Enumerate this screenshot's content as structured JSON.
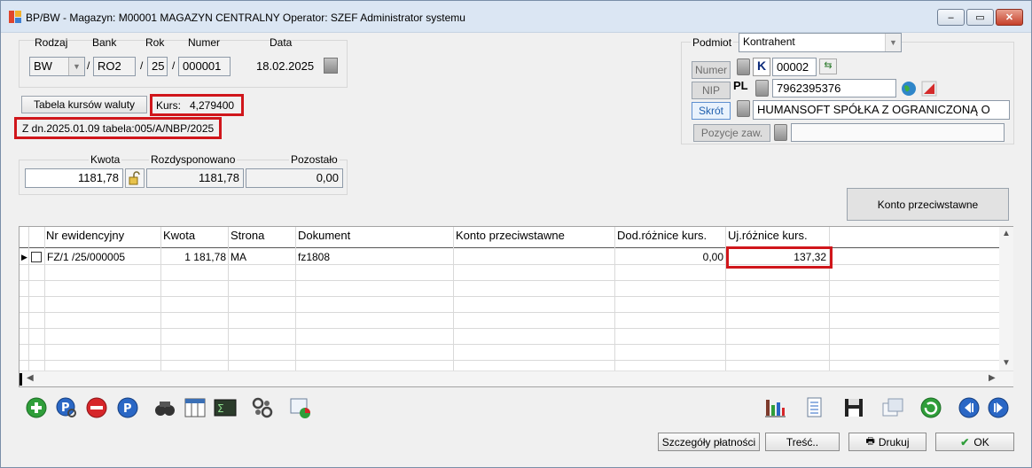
{
  "window": {
    "title": "BP/BW - Magazyn: M00001 MAGAZYN CENTRALNY  Operator: SZEF Administrator systemu",
    "minimize": "–",
    "maximize": "▭",
    "close": "✕"
  },
  "header": {
    "rodzaj_label": "Rodzaj",
    "bank_label": "Bank",
    "rok_label": "Rok",
    "numer_label": "Numer",
    "data_label": "Data",
    "rodzaj_value": "BW",
    "bank_value": "RO2",
    "rok_value": "25",
    "numer_value": "000001",
    "data_value": "18.02.2025",
    "slash": "/"
  },
  "exchange": {
    "table_button": "Tabela kursów waluty",
    "rate_label": "Kurs:",
    "rate_value": "4,279400",
    "table_info": "Z dn.2025.01.09 tabela:005/A/NBP/2025"
  },
  "amounts": {
    "kwota_label": "Kwota",
    "rozdysponowano_label": "Rozdysponowano",
    "pozostalo_label": "Pozostało",
    "kwota_value": "1181,78",
    "rozdysponowano_value": "1181,78",
    "pozostalo_value": "0,00"
  },
  "podmiot": {
    "label": "Podmiot",
    "type_value": "Kontrahent",
    "numer_button": "Numer",
    "nip_button": "NIP",
    "skrot_button": "Skrót",
    "pozycje_button": "Pozycje zaw.",
    "k_badge": "K",
    "numer_value": "00002",
    "pl_badge": "PL",
    "nip_value": "7962395376",
    "skrot_value": "HUMANSOFT SPÓŁKA Z OGRANICZONĄ O",
    "pozycje_value": ""
  },
  "konto_button": "Konto przeciwstawne",
  "grid": {
    "columns": [
      "Nr ewidencyjny",
      "Kwota",
      "Strona",
      "Dokument",
      "Konto przeciwstawne",
      "Dod.różnice kurs.",
      "Uj.różnice kurs."
    ],
    "rows": [
      {
        "nr": "FZ/1  /25/000005",
        "kwota": "1 181,78",
        "strona": "MA",
        "dokument": "fz1808",
        "konto": "",
        "dod": "0,00",
        "uj": "137,32"
      }
    ]
  },
  "footer": {
    "szczegoly": "Szczegóły płatności",
    "tresc": "Treść..",
    "drukuj": "Drukuj",
    "ok": "OK"
  },
  "colors": {
    "highlight_red": "#d0161b",
    "accent_blue": "#1f5fae",
    "green_icon": "#2f9e3a"
  }
}
